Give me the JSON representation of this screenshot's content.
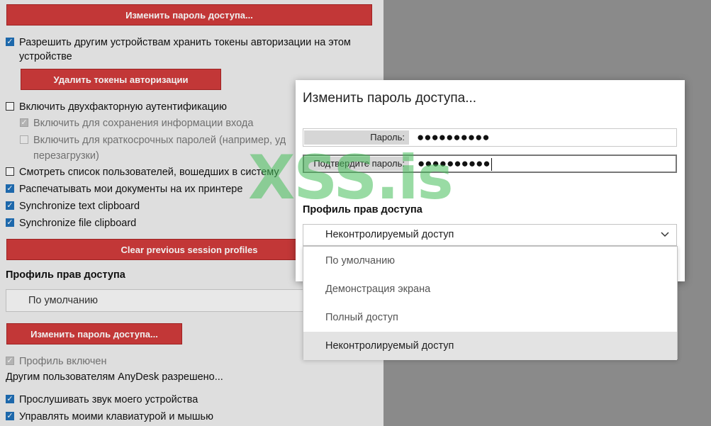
{
  "left_panel": {
    "change_password_top": "Изменить пароль доступа...",
    "allow_tokens": "Разрешить другим устройствам хранить токены авторизации на этом устройстве",
    "delete_tokens": "Удалить токены авторизации",
    "enable_2fa": "Включить двухфакторную аутентификацию",
    "enable_2fa_saved_login": "Включить для сохранения информации входа",
    "enable_2fa_short_passwords": "Включить для краткосрочных паролей (например, уд",
    "enable_2fa_short_passwords_cont": "перезагрузки)",
    "view_logged_users": "Смотреть список пользователей, вошедших в систему",
    "print_docs": "Распечатывать мои документы на их принтере",
    "sync_text": "Synchronize text clipboard",
    "sync_file": "Synchronize file clipboard",
    "clear_profiles": "Clear previous session profiles",
    "profile_heading": "Профиль прав доступа",
    "profile_value": "По умолчанию",
    "change_password_bottom": "Изменить пароль доступа...",
    "profile_enabled": "Профиль включен",
    "others_allowed": "Другим пользователям AnyDesk разрешено...",
    "listen_sound": "Прослушивать звук моего устройства",
    "control_input": "Управлять моими клавиатурой и мышью"
  },
  "dialog": {
    "title": "Изменить пароль доступа...",
    "password_label": "Пароль:",
    "password_value": "●●●●●●●●●●",
    "confirm_label": "Подтвердите пароль:",
    "confirm_value": "●●●●●●●●●●",
    "profile_heading": "Профиль прав доступа",
    "selected_profile": "Неконтролируемый доступ",
    "options": [
      "По умолчанию",
      "Демонстрация экрана",
      "Полный доступ",
      "Неконтролируемый доступ"
    ]
  },
  "watermark": "XSS.is",
  "colors": {
    "accent_red": "#cf3b3b",
    "check_blue": "#1f6fb6"
  }
}
